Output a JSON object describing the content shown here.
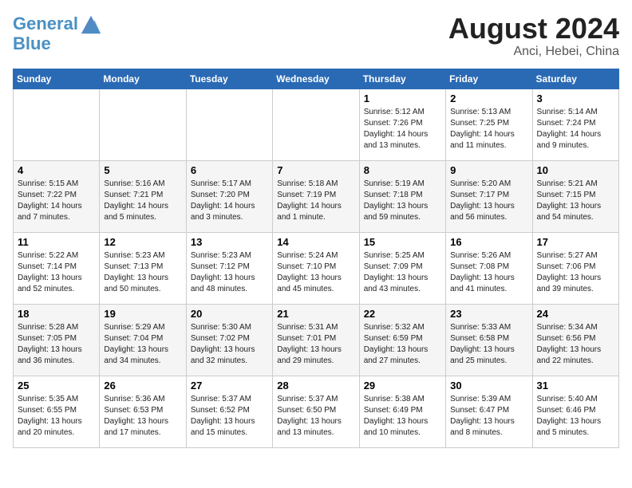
{
  "header": {
    "logo_line1": "General",
    "logo_line2": "Blue",
    "month_year": "August 2024",
    "location": "Anci, Hebei, China"
  },
  "weekdays": [
    "Sunday",
    "Monday",
    "Tuesday",
    "Wednesday",
    "Thursday",
    "Friday",
    "Saturday"
  ],
  "weeks": [
    [
      {
        "day": "",
        "info": ""
      },
      {
        "day": "",
        "info": ""
      },
      {
        "day": "",
        "info": ""
      },
      {
        "day": "",
        "info": ""
      },
      {
        "day": "1",
        "info": "Sunrise: 5:12 AM\nSunset: 7:26 PM\nDaylight: 14 hours\nand 13 minutes."
      },
      {
        "day": "2",
        "info": "Sunrise: 5:13 AM\nSunset: 7:25 PM\nDaylight: 14 hours\nand 11 minutes."
      },
      {
        "day": "3",
        "info": "Sunrise: 5:14 AM\nSunset: 7:24 PM\nDaylight: 14 hours\nand 9 minutes."
      }
    ],
    [
      {
        "day": "4",
        "info": "Sunrise: 5:15 AM\nSunset: 7:22 PM\nDaylight: 14 hours\nand 7 minutes."
      },
      {
        "day": "5",
        "info": "Sunrise: 5:16 AM\nSunset: 7:21 PM\nDaylight: 14 hours\nand 5 minutes."
      },
      {
        "day": "6",
        "info": "Sunrise: 5:17 AM\nSunset: 7:20 PM\nDaylight: 14 hours\nand 3 minutes."
      },
      {
        "day": "7",
        "info": "Sunrise: 5:18 AM\nSunset: 7:19 PM\nDaylight: 14 hours\nand 1 minute."
      },
      {
        "day": "8",
        "info": "Sunrise: 5:19 AM\nSunset: 7:18 PM\nDaylight: 13 hours\nand 59 minutes."
      },
      {
        "day": "9",
        "info": "Sunrise: 5:20 AM\nSunset: 7:17 PM\nDaylight: 13 hours\nand 56 minutes."
      },
      {
        "day": "10",
        "info": "Sunrise: 5:21 AM\nSunset: 7:15 PM\nDaylight: 13 hours\nand 54 minutes."
      }
    ],
    [
      {
        "day": "11",
        "info": "Sunrise: 5:22 AM\nSunset: 7:14 PM\nDaylight: 13 hours\nand 52 minutes."
      },
      {
        "day": "12",
        "info": "Sunrise: 5:23 AM\nSunset: 7:13 PM\nDaylight: 13 hours\nand 50 minutes."
      },
      {
        "day": "13",
        "info": "Sunrise: 5:23 AM\nSunset: 7:12 PM\nDaylight: 13 hours\nand 48 minutes."
      },
      {
        "day": "14",
        "info": "Sunrise: 5:24 AM\nSunset: 7:10 PM\nDaylight: 13 hours\nand 45 minutes."
      },
      {
        "day": "15",
        "info": "Sunrise: 5:25 AM\nSunset: 7:09 PM\nDaylight: 13 hours\nand 43 minutes."
      },
      {
        "day": "16",
        "info": "Sunrise: 5:26 AM\nSunset: 7:08 PM\nDaylight: 13 hours\nand 41 minutes."
      },
      {
        "day": "17",
        "info": "Sunrise: 5:27 AM\nSunset: 7:06 PM\nDaylight: 13 hours\nand 39 minutes."
      }
    ],
    [
      {
        "day": "18",
        "info": "Sunrise: 5:28 AM\nSunset: 7:05 PM\nDaylight: 13 hours\nand 36 minutes."
      },
      {
        "day": "19",
        "info": "Sunrise: 5:29 AM\nSunset: 7:04 PM\nDaylight: 13 hours\nand 34 minutes."
      },
      {
        "day": "20",
        "info": "Sunrise: 5:30 AM\nSunset: 7:02 PM\nDaylight: 13 hours\nand 32 minutes."
      },
      {
        "day": "21",
        "info": "Sunrise: 5:31 AM\nSunset: 7:01 PM\nDaylight: 13 hours\nand 29 minutes."
      },
      {
        "day": "22",
        "info": "Sunrise: 5:32 AM\nSunset: 6:59 PM\nDaylight: 13 hours\nand 27 minutes."
      },
      {
        "day": "23",
        "info": "Sunrise: 5:33 AM\nSunset: 6:58 PM\nDaylight: 13 hours\nand 25 minutes."
      },
      {
        "day": "24",
        "info": "Sunrise: 5:34 AM\nSunset: 6:56 PM\nDaylight: 13 hours\nand 22 minutes."
      }
    ],
    [
      {
        "day": "25",
        "info": "Sunrise: 5:35 AM\nSunset: 6:55 PM\nDaylight: 13 hours\nand 20 minutes."
      },
      {
        "day": "26",
        "info": "Sunrise: 5:36 AM\nSunset: 6:53 PM\nDaylight: 13 hours\nand 17 minutes."
      },
      {
        "day": "27",
        "info": "Sunrise: 5:37 AM\nSunset: 6:52 PM\nDaylight: 13 hours\nand 15 minutes."
      },
      {
        "day": "28",
        "info": "Sunrise: 5:37 AM\nSunset: 6:50 PM\nDaylight: 13 hours\nand 13 minutes."
      },
      {
        "day": "29",
        "info": "Sunrise: 5:38 AM\nSunset: 6:49 PM\nDaylight: 13 hours\nand 10 minutes."
      },
      {
        "day": "30",
        "info": "Sunrise: 5:39 AM\nSunset: 6:47 PM\nDaylight: 13 hours\nand 8 minutes."
      },
      {
        "day": "31",
        "info": "Sunrise: 5:40 AM\nSunset: 6:46 PM\nDaylight: 13 hours\nand 5 minutes."
      }
    ]
  ]
}
